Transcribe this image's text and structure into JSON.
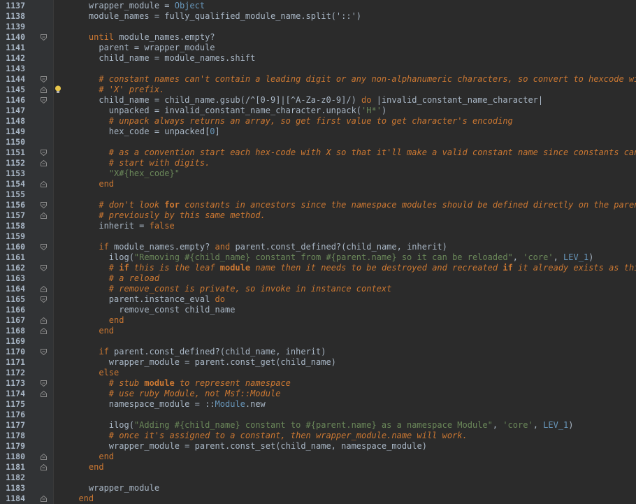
{
  "editor": {
    "lines": [
      {
        "num": "1137",
        "fold": "",
        "tokens": [
          {
            "t": "    wrapper_module = ",
            "c": "t-plain"
          },
          {
            "t": "Object",
            "c": "t-const"
          }
        ]
      },
      {
        "num": "1138",
        "fold": "",
        "tokens": [
          {
            "t": "    module_names = fully_qualified_module_name.split('::')",
            "c": "t-plain"
          }
        ]
      },
      {
        "num": "1139",
        "fold": "",
        "tokens": []
      },
      {
        "num": "1140",
        "fold": "open",
        "tokens": [
          {
            "t": "    ",
            "c": "t-plain"
          },
          {
            "t": "until",
            "c": "t-kw"
          },
          {
            "t": " module_names.empty?",
            "c": "t-plain"
          }
        ]
      },
      {
        "num": "1141",
        "fold": "",
        "tokens": [
          {
            "t": "      parent = wrapper_module",
            "c": "t-plain"
          }
        ]
      },
      {
        "num": "1142",
        "fold": "",
        "tokens": [
          {
            "t": "      child_name = module_names.shift",
            "c": "t-plain"
          }
        ]
      },
      {
        "num": "1143",
        "fold": "",
        "tokens": []
      },
      {
        "num": "1144",
        "fold": "open",
        "tokens": [
          {
            "t": "      # constant names can't contain a leading digit or any non-alphanumeric characters, so convert to hexcode with",
            "c": "t-com"
          }
        ]
      },
      {
        "num": "1145",
        "fold": "close",
        "bulb": true,
        "tokens": [
          {
            "t": "      # 'X' prefix.",
            "c": "t-com"
          }
        ]
      },
      {
        "num": "1146",
        "fold": "open",
        "tokens": [
          {
            "t": "      child_name = child_name.gsub(/^[0-9]|[^A-Za-z0-9]/) ",
            "c": "t-plain"
          },
          {
            "t": "do",
            "c": "t-kw"
          },
          {
            "t": " |invalid_constant_name_character|",
            "c": "t-plain"
          }
        ]
      },
      {
        "num": "1147",
        "fold": "",
        "tokens": [
          {
            "t": "        unpacked = invalid_constant_name_character.unpack(",
            "c": "t-plain"
          },
          {
            "t": "'H*'",
            "c": "t-str"
          },
          {
            "t": ")",
            "c": "t-plain"
          }
        ]
      },
      {
        "num": "1148",
        "fold": "",
        "tokens": [
          {
            "t": "        # unpack always returns an array, so get first value to get character's encoding",
            "c": "t-com"
          }
        ]
      },
      {
        "num": "1149",
        "fold": "",
        "tokens": [
          {
            "t": "        hex_code = unpacked[",
            "c": "t-plain"
          },
          {
            "t": "0",
            "c": "t-const"
          },
          {
            "t": "]",
            "c": "t-plain"
          }
        ]
      },
      {
        "num": "1150",
        "fold": "",
        "tokens": []
      },
      {
        "num": "1151",
        "fold": "open",
        "tokens": [
          {
            "t": "        # as a convention start each hex-code with X so that it'll make a valid constant name since constants can't",
            "c": "t-com"
          }
        ]
      },
      {
        "num": "1152",
        "fold": "close",
        "tokens": [
          {
            "t": "        # start with digits.",
            "c": "t-com"
          }
        ]
      },
      {
        "num": "1153",
        "fold": "",
        "tokens": [
          {
            "t": "        \"X#{hex_code}\"",
            "c": "t-str"
          }
        ]
      },
      {
        "num": "1154",
        "fold": "close",
        "tokens": [
          {
            "t": "      ",
            "c": "t-plain"
          },
          {
            "t": "end",
            "c": "t-kw"
          }
        ]
      },
      {
        "num": "1155",
        "fold": "",
        "tokens": []
      },
      {
        "num": "1156",
        "fold": "open",
        "tokens": [
          {
            "t": "      # don't look ",
            "c": "t-com"
          },
          {
            "t": "for",
            "c": "t-kw t-bold"
          },
          {
            "t": " constants in ancestors since the namespace modules should be defined directly on the parent and",
            "c": "t-com"
          }
        ]
      },
      {
        "num": "1157",
        "fold": "close",
        "tokens": [
          {
            "t": "      # previously by this same method.",
            "c": "t-com"
          }
        ]
      },
      {
        "num": "1158",
        "fold": "",
        "tokens": [
          {
            "t": "      inherit = ",
            "c": "t-plain"
          },
          {
            "t": "false",
            "c": "t-kw"
          }
        ]
      },
      {
        "num": "1159",
        "fold": "",
        "tokens": []
      },
      {
        "num": "1160",
        "fold": "open",
        "tokens": [
          {
            "t": "      ",
            "c": "t-plain"
          },
          {
            "t": "if",
            "c": "t-kw"
          },
          {
            "t": " module_names.empty? ",
            "c": "t-plain"
          },
          {
            "t": "and",
            "c": "t-kw"
          },
          {
            "t": " parent.const_defined?(child_name, inherit)",
            "c": "t-plain"
          }
        ]
      },
      {
        "num": "1161",
        "fold": "",
        "tokens": [
          {
            "t": "        ilog(",
            "c": "t-plain"
          },
          {
            "t": "\"Removing #{child_name} constant from #{parent.name} so it can be reloaded\"",
            "c": "t-str"
          },
          {
            "t": ", ",
            "c": "t-plain"
          },
          {
            "t": "'core'",
            "c": "t-str"
          },
          {
            "t": ", ",
            "c": "t-plain"
          },
          {
            "t": "LEV_1",
            "c": "t-const"
          },
          {
            "t": ")",
            "c": "t-plain"
          }
        ]
      },
      {
        "num": "1162",
        "fold": "open",
        "tokens": [
          {
            "t": "        # ",
            "c": "t-com"
          },
          {
            "t": "if",
            "c": "t-kw t-bold"
          },
          {
            "t": " this is the leaf ",
            "c": "t-com"
          },
          {
            "t": "module",
            "c": "t-kw t-bold"
          },
          {
            "t": " name then it needs to be destroyed and recreated ",
            "c": "t-com"
          },
          {
            "t": "if",
            "c": "t-kw t-bold"
          },
          {
            "t": " it already exists as this is",
            "c": "t-com"
          }
        ]
      },
      {
        "num": "1163",
        "fold": "",
        "tokens": [
          {
            "t": "        # a reload",
            "c": "t-com"
          }
        ]
      },
      {
        "num": "1164",
        "fold": "close",
        "tokens": [
          {
            "t": "        # remove_const is private, so invoke in instance context",
            "c": "t-com"
          }
        ]
      },
      {
        "num": "1165",
        "fold": "open",
        "tokens": [
          {
            "t": "        parent.instance_eval ",
            "c": "t-plain"
          },
          {
            "t": "do",
            "c": "t-kw"
          }
        ]
      },
      {
        "num": "1166",
        "fold": "",
        "tokens": [
          {
            "t": "          remove_const child_name",
            "c": "t-plain"
          }
        ]
      },
      {
        "num": "1167",
        "fold": "close",
        "tokens": [
          {
            "t": "        ",
            "c": "t-plain"
          },
          {
            "t": "end",
            "c": "t-kw"
          }
        ]
      },
      {
        "num": "1168",
        "fold": "close",
        "tokens": [
          {
            "t": "      ",
            "c": "t-plain"
          },
          {
            "t": "end",
            "c": "t-kw"
          }
        ]
      },
      {
        "num": "1169",
        "fold": "",
        "tokens": []
      },
      {
        "num": "1170",
        "fold": "open",
        "tokens": [
          {
            "t": "      ",
            "c": "t-plain"
          },
          {
            "t": "if",
            "c": "t-kw"
          },
          {
            "t": " parent.const_defined?(child_name, inherit)",
            "c": "t-plain"
          }
        ]
      },
      {
        "num": "1171",
        "fold": "",
        "tokens": [
          {
            "t": "        wrapper_module = parent.const_get(child_name)",
            "c": "t-plain"
          }
        ]
      },
      {
        "num": "1172",
        "fold": "",
        "tokens": [
          {
            "t": "      ",
            "c": "t-plain"
          },
          {
            "t": "else",
            "c": "t-kw"
          }
        ]
      },
      {
        "num": "1173",
        "fold": "open",
        "tokens": [
          {
            "t": "        # stub ",
            "c": "t-com"
          },
          {
            "t": "module",
            "c": "t-kw t-bold"
          },
          {
            "t": " to represent namespace",
            "c": "t-com"
          }
        ]
      },
      {
        "num": "1174",
        "fold": "close",
        "tokens": [
          {
            "t": "        # use ruby Module, not Msf::Module",
            "c": "t-com"
          }
        ]
      },
      {
        "num": "1175",
        "fold": "",
        "tokens": [
          {
            "t": "        namespace_module = ::",
            "c": "t-plain"
          },
          {
            "t": "Module",
            "c": "t-const"
          },
          {
            "t": ".new",
            "c": "t-plain"
          }
        ]
      },
      {
        "num": "1176",
        "fold": "",
        "tokens": []
      },
      {
        "num": "1177",
        "fold": "",
        "tokens": [
          {
            "t": "        ilog(",
            "c": "t-plain"
          },
          {
            "t": "\"Adding #{child_name} constant to #{parent.name} as a namespace Module\"",
            "c": "t-str"
          },
          {
            "t": ", ",
            "c": "t-plain"
          },
          {
            "t": "'core'",
            "c": "t-str"
          },
          {
            "t": ", ",
            "c": "t-plain"
          },
          {
            "t": "LEV_1",
            "c": "t-const"
          },
          {
            "t": ")",
            "c": "t-plain"
          }
        ]
      },
      {
        "num": "1178",
        "fold": "",
        "tokens": [
          {
            "t": "        # once it's assigned to a constant, then wrapper_module.name will work.",
            "c": "t-com"
          }
        ]
      },
      {
        "num": "1179",
        "fold": "",
        "tokens": [
          {
            "t": "        wrapper_module = parent.const_set(child_name, namespace_module)",
            "c": "t-plain"
          }
        ]
      },
      {
        "num": "1180",
        "fold": "close",
        "tokens": [
          {
            "t": "      ",
            "c": "t-plain"
          },
          {
            "t": "end",
            "c": "t-kw"
          }
        ]
      },
      {
        "num": "1181",
        "fold": "close",
        "tokens": [
          {
            "t": "    ",
            "c": "t-plain"
          },
          {
            "t": "end",
            "c": "t-kw"
          }
        ]
      },
      {
        "num": "1182",
        "fold": "",
        "tokens": []
      },
      {
        "num": "1183",
        "fold": "",
        "tokens": [
          {
            "t": "    wrapper_module",
            "c": "t-plain"
          }
        ]
      },
      {
        "num": "1184",
        "fold": "close",
        "tokens": [
          {
            "t": "  ",
            "c": "t-plain"
          },
          {
            "t": "end",
            "c": "t-kw"
          }
        ]
      }
    ]
  }
}
